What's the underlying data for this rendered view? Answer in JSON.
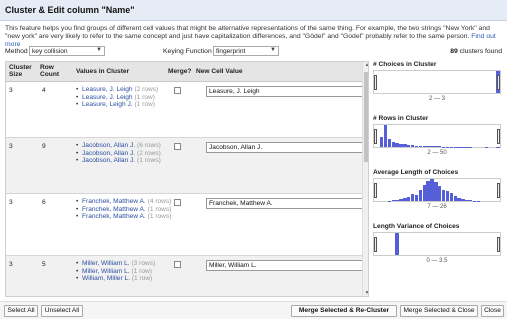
{
  "dialog": {
    "title": "Cluster & Edit column \"Name\"",
    "intro": "This feature helps you find groups of different cell values that might be alternative representations of the same thing. For example, the two strings \"New York\" and \"new york\" are very likely to refer to the same concept and just have capitalization differences, and \"Gödel\" and \"Godel\" probably refer to the same person.",
    "find_out_more": "Find out more"
  },
  "controls": {
    "method_label": "Method",
    "method_value": "key collision",
    "keying_label": "Keying Function",
    "keying_value": "fingerprint",
    "clusters_count": "89",
    "clusters_suffix": "clusters found"
  },
  "table": {
    "headers": {
      "cluster_size": "Cluster Size",
      "row_count": "Row Count",
      "values": "Values in Cluster",
      "merge": "Merge?",
      "new_value": "New Cell Value"
    },
    "rows": [
      {
        "size": "3",
        "count": "4",
        "values": [
          {
            "text": "Leasure, J. Leigh",
            "rows": "(2 rows)"
          },
          {
            "text": "Leasure, J. Leigh",
            "rows": "(1 row)"
          },
          {
            "text": "Leasure, Leigh J.",
            "rows": "(1 row)"
          }
        ],
        "new_value": "Leasure, J. Leigh"
      },
      {
        "size": "3",
        "count": "9",
        "values": [
          {
            "text": "Jacobson, Allan J.",
            "rows": "(6 rows)"
          },
          {
            "text": "Jacobson, Allan J.",
            "rows": "(2 rows)"
          },
          {
            "text": "Jacobson, Allan J.",
            "rows": "(1 rows)"
          }
        ],
        "new_value": "Jacobson, Allan J."
      },
      {
        "size": "3",
        "count": "6",
        "values": [
          {
            "text": "Franchek, Matthew A.",
            "rows": "(4 rows)"
          },
          {
            "text": "Franchek, Matthew A.",
            "rows": "(1 rows)"
          },
          {
            "text": "Franchek, Matthew A.",
            "rows": "(1 rows)"
          }
        ],
        "new_value": "Franchek, Matthew A."
      },
      {
        "size": "3",
        "count": "5",
        "values": [
          {
            "text": "Miller, William L.",
            "rows": "(3 rows)"
          },
          {
            "text": "Miller, William L.",
            "rows": "(1 row)"
          },
          {
            "text": "William, Miller L.",
            "rows": "(1 row)"
          }
        ],
        "new_value": "Miller, William L."
      },
      {
        "size": "3",
        "count": "5",
        "values": [
          {
            "text": "Tsokos, Nikolaos V.",
            "rows": "(2"
          }
        ],
        "new_value": "Tsokos, Nikolaos V."
      }
    ]
  },
  "facets": [
    {
      "title": "# Choices in Cluster",
      "range": "2 — 3"
    },
    {
      "title": "# Rows in Cluster",
      "range": "2 — 50"
    },
    {
      "title": "Average Length of Choices",
      "range": "7 — 26"
    },
    {
      "title": "Length Variance of Choices",
      "range": "0 — 3.5"
    }
  ],
  "histograms": [
    [
      0,
      0,
      0,
      0,
      0,
      0,
      0,
      0,
      0,
      0,
      0,
      0,
      0,
      0,
      0,
      0,
      0,
      0,
      0,
      0,
      0,
      0,
      0,
      0,
      0,
      0,
      0,
      0,
      0,
      0,
      0,
      1.0
    ],
    [
      0,
      0.45,
      1.0,
      0.35,
      0.25,
      0.2,
      0.15,
      0.12,
      0.1,
      0.1,
      0.06,
      0.05,
      0.05,
      0.04,
      0.04,
      0.03,
      0.03,
      0.02,
      0.02,
      0.02,
      0.02,
      0.01,
      0.01,
      0.01,
      0.01,
      0,
      0,
      0,
      0.01,
      0,
      0,
      0.01
    ],
    [
      0,
      0,
      0,
      0.02,
      0.04,
      0.06,
      0.1,
      0.15,
      0.2,
      0.3,
      0.28,
      0.5,
      0.75,
      0.92,
      1.0,
      0.85,
      0.7,
      0.5,
      0.45,
      0.35,
      0.25,
      0.15,
      0.1,
      0.06,
      0.03,
      0.02,
      0.01,
      0,
      0,
      0,
      0,
      0
    ],
    [
      0,
      0,
      0,
      0,
      0,
      1.0,
      0,
      0,
      0,
      0,
      0,
      0,
      0,
      0,
      0,
      0,
      0,
      0,
      0,
      0,
      0,
      0,
      0,
      0,
      0,
      0,
      0,
      0,
      0,
      0,
      0,
      0
    ]
  ],
  "footer": {
    "select_all": "Select All",
    "unselect_all": "Unselect All",
    "merge_recluster": "Merge Selected & Re-Cluster",
    "merge_close": "Merge Selected & Close",
    "close": "Close"
  },
  "colors": {
    "accent": "#5560d8",
    "link": "#2a4fa0"
  }
}
